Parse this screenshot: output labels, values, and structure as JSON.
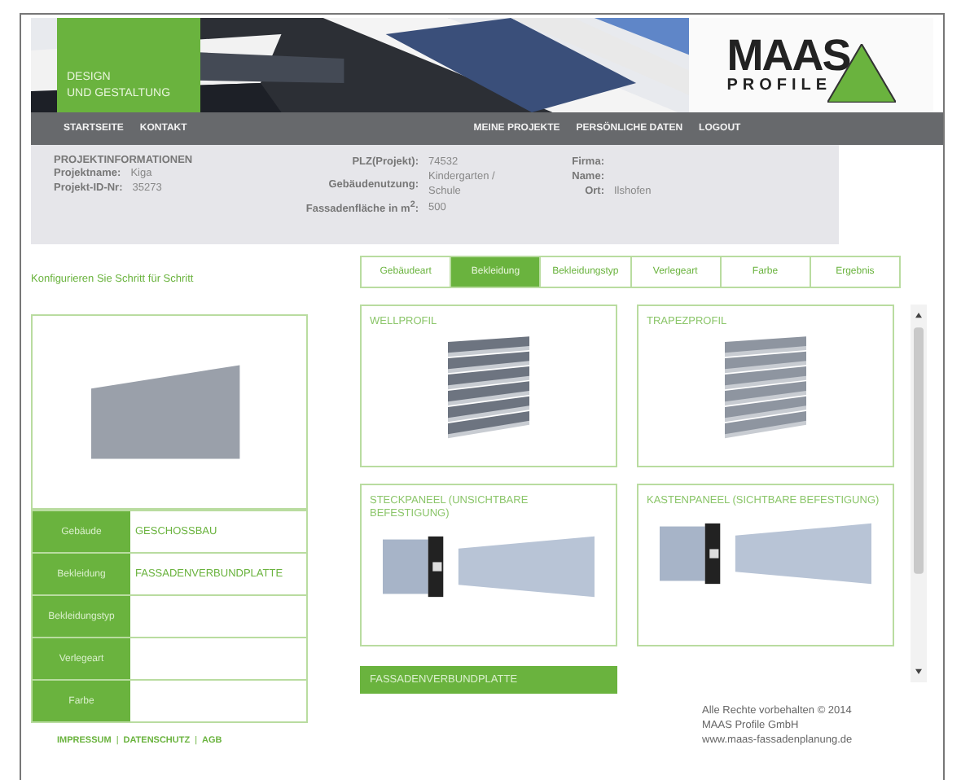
{
  "header": {
    "tagline": [
      "DESIGN",
      "UND GESTALTUNG"
    ],
    "logo": {
      "name": "MAAS",
      "sub": "PROFILE"
    }
  },
  "nav": {
    "left": [
      "STARTSEITE",
      "KONTAKT"
    ],
    "right": [
      "MEINE PROJEKTE",
      "PERSÖNLICHE DATEN",
      "LOGOUT"
    ]
  },
  "project_info": {
    "title": "PROJEKTINFORMATIONEN",
    "column_1": [
      {
        "label": "Projektname:",
        "value": "Kiga"
      },
      {
        "label": "Projekt-ID-Nr:",
        "value": "35273"
      }
    ],
    "column_2": [
      {
        "label": "PLZ(Projekt):",
        "value": "74532"
      },
      {
        "label": "Gebäudenutzung:",
        "value": "Kindergarten / Schule"
      },
      {
        "label": "Fassadenfläche in m$^{2}$:",
        "value": "500"
      }
    ],
    "column_3": [
      {
        "label": "Firma:"
      },
      {
        "label": "Name:"
      },
      {
        "label": "Ort:",
        "value": "Ilshofen"
      }
    ]
  },
  "config": {
    "heading": "Konfigurieren Sie Schritt für Schritt",
    "tabs": [
      {
        "label": "Gebäudeart",
        "selected": false
      },
      {
        "label": "Bekleidung",
        "selected": true
      },
      {
        "label": "Bekleidungstyp",
        "selected": false
      },
      {
        "label": "Verlegeart",
        "selected": false
      },
      {
        "label": "Farbe",
        "selected": false
      },
      {
        "label": "Ergebnis",
        "selected": false
      }
    ],
    "summary": [
      {
        "label": "Gebäude",
        "value": "GESCHOSSBAU"
      },
      {
        "label": "Bekleidung",
        "value": "FASSADENVERBUNDPLATTE"
      },
      {
        "label": "Bekleidungstyp"
      },
      {
        "label": "Verlegeart"
      },
      {
        "label": "Farbe"
      }
    ],
    "options": [
      {
        "title": "WELLPROFIL",
        "kind": "wave"
      },
      {
        "title": "TRAPEZPROFIL",
        "kind": "trapez"
      },
      {
        "title": "STECKPANEEL (UNSICHTBARE BEFESTIGUNG)",
        "kind": "panel"
      },
      {
        "title": "KASTENPANEEL (SICHTBARE BEFESTIGUNG)",
        "kind": "panel"
      }
    ],
    "next_option": "FASSADENVERBUNDPLATTE"
  },
  "footer": {
    "links": [
      "IMPRESSUM",
      "DATENSCHUTZ",
      "AGB"
    ],
    "separator": "|",
    "copyright": [
      "Alle Rechte vorbehalten © 2014",
      "MAAS Profile GmbH",
      "www.maas-fassadenplanung.de"
    ]
  }
}
